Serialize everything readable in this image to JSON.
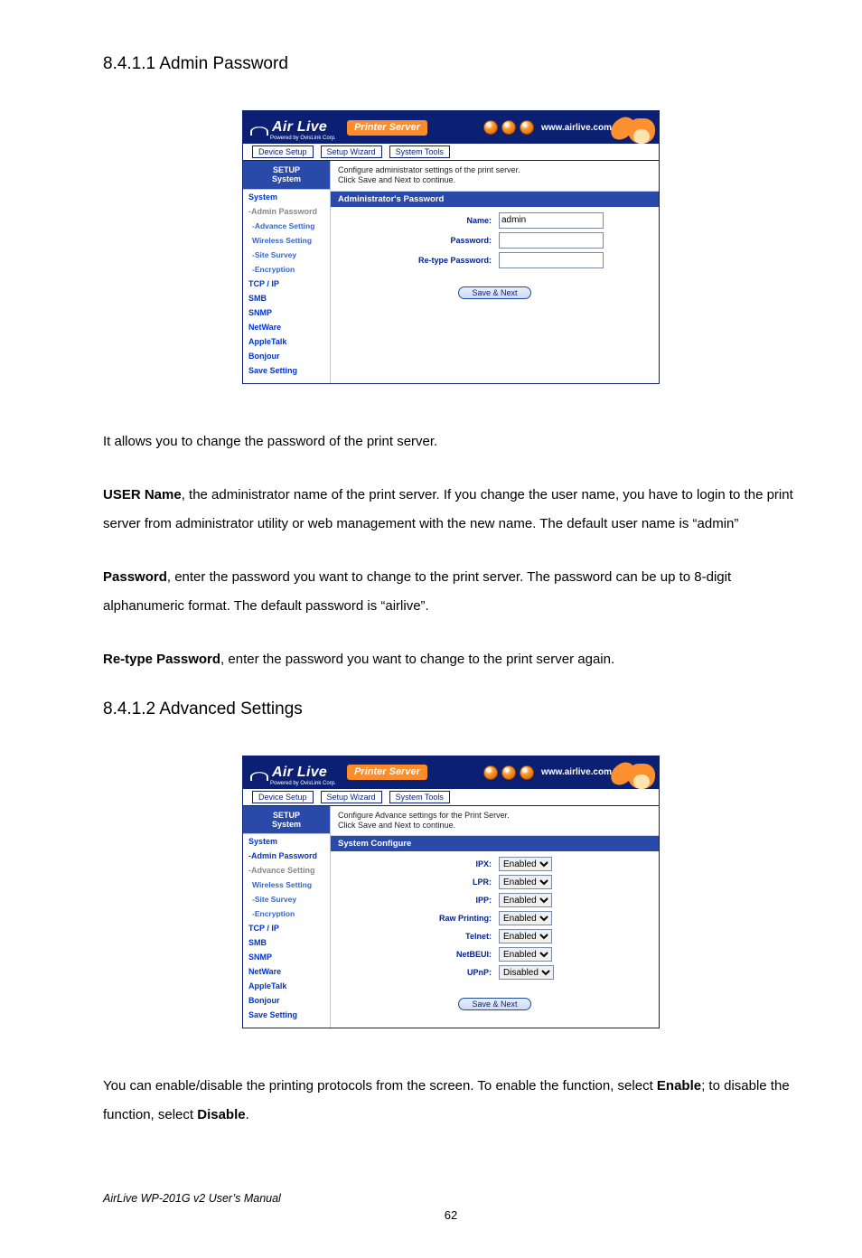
{
  "doc": {
    "h8_4_1_1": "8.4.1.1 Admin Password",
    "p1": "It allows you to change the password of the print server.",
    "p2a": "USER Name",
    "p2b": ", the administrator name of the print server. If you change the user name, you have to login to the print server from administrator utility or web management with the new name. The default user name is “admin”",
    "p3a": "Password",
    "p3b": ", enter the password you want to change to the print server. The password can be up to 8-digit alphanumeric format. The default password is “airlive”.",
    "p4a": "Re-type Password",
    "p4b": ", enter the password you want to change to the print server again.",
    "h8_4_1_2": "8.4.1.2 Advanced Settings",
    "p5a": "You can enable/disable the printing protocols from the screen. To enable the function, select ",
    "p5enable": "Enable",
    "p5b": "; to disable the function, select ",
    "p5disable": "Disable",
    "p5c": ".",
    "footer": "AirLive WP-201G v2 User’s Manual",
    "pagenum": "62"
  },
  "banner": {
    "logo": "Air Live",
    "powered": "Powered by OvisLink Corp.",
    "printer_server": "Printer Server",
    "url": "www.airlive.com"
  },
  "tabs": {
    "t1": "Device Setup",
    "t2": "Setup Wizard",
    "t3": "System Tools"
  },
  "sidebar": {
    "setup1": "SETUP",
    "setup2": "System",
    "items": [
      {
        "label": "System"
      },
      {
        "label": "-Admin Password"
      },
      {
        "label": "-Advance Setting"
      },
      {
        "label": "Wireless Setting"
      },
      {
        "label": "-Site Survey"
      },
      {
        "label": "-Encryption"
      },
      {
        "label": "TCP / IP"
      },
      {
        "label": "SMB"
      },
      {
        "label": "SNMP"
      },
      {
        "label": "NetWare"
      },
      {
        "label": "AppleTalk"
      },
      {
        "label": "Bonjour"
      },
      {
        "label": "Save Setting"
      }
    ]
  },
  "shot1": {
    "desc": "Configure administrator settings of the print server.\nClick Save and Next to continue.",
    "section": "Administrator's Password",
    "name_label": "Name:",
    "name_value": "admin",
    "pw_label": "Password:",
    "pw2_label": "Re-type Password:",
    "button": "Save & Next"
  },
  "shot2": {
    "desc": "Configure Advance settings for the Print Server.\nClick Save and Next to continue.",
    "section": "System Configure",
    "rows": [
      {
        "label": "IPX:",
        "value": "Enabled"
      },
      {
        "label": "LPR:",
        "value": "Enabled"
      },
      {
        "label": "IPP:",
        "value": "Enabled"
      },
      {
        "label": "Raw Printing:",
        "value": "Enabled"
      },
      {
        "label": "Telnet:",
        "value": "Enabled"
      },
      {
        "label": "NetBEUI:",
        "value": "Enabled"
      },
      {
        "label": "UPnP:",
        "value": "Disabled"
      }
    ],
    "button": "Save & Next"
  }
}
